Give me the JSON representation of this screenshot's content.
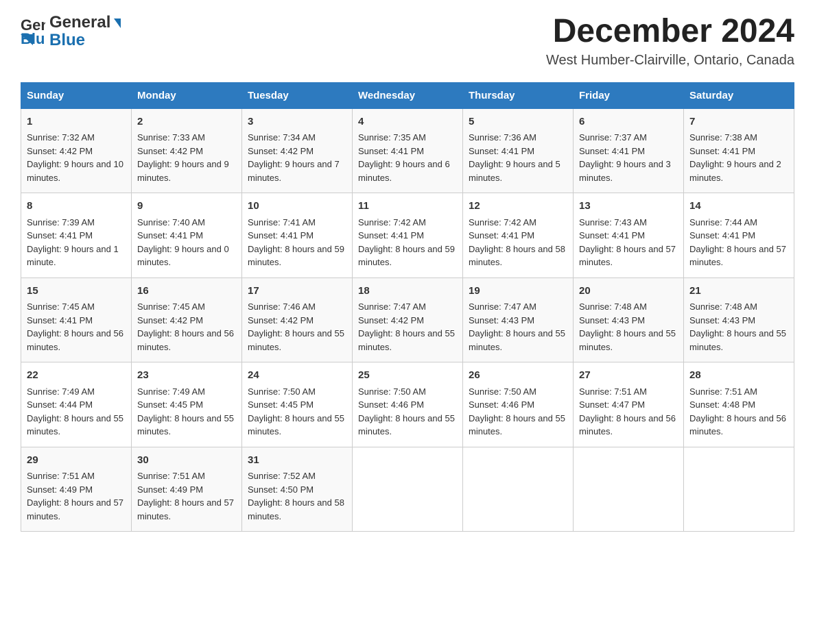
{
  "header": {
    "logo": {
      "text_general": "General",
      "text_blue": "Blue",
      "triangle_color": "#1a6faf"
    },
    "title": "December 2024",
    "location": "West Humber-Clairville, Ontario, Canada"
  },
  "weekdays": [
    "Sunday",
    "Monday",
    "Tuesday",
    "Wednesday",
    "Thursday",
    "Friday",
    "Saturday"
  ],
  "weeks": [
    [
      {
        "day": "1",
        "sunrise": "7:32 AM",
        "sunset": "4:42 PM",
        "daylight": "9 hours and 10 minutes."
      },
      {
        "day": "2",
        "sunrise": "7:33 AM",
        "sunset": "4:42 PM",
        "daylight": "9 hours and 9 minutes."
      },
      {
        "day": "3",
        "sunrise": "7:34 AM",
        "sunset": "4:42 PM",
        "daylight": "9 hours and 7 minutes."
      },
      {
        "day": "4",
        "sunrise": "7:35 AM",
        "sunset": "4:41 PM",
        "daylight": "9 hours and 6 minutes."
      },
      {
        "day": "5",
        "sunrise": "7:36 AM",
        "sunset": "4:41 PM",
        "daylight": "9 hours and 5 minutes."
      },
      {
        "day": "6",
        "sunrise": "7:37 AM",
        "sunset": "4:41 PM",
        "daylight": "9 hours and 3 minutes."
      },
      {
        "day": "7",
        "sunrise": "7:38 AM",
        "sunset": "4:41 PM",
        "daylight": "9 hours and 2 minutes."
      }
    ],
    [
      {
        "day": "8",
        "sunrise": "7:39 AM",
        "sunset": "4:41 PM",
        "daylight": "9 hours and 1 minute."
      },
      {
        "day": "9",
        "sunrise": "7:40 AM",
        "sunset": "4:41 PM",
        "daylight": "9 hours and 0 minutes."
      },
      {
        "day": "10",
        "sunrise": "7:41 AM",
        "sunset": "4:41 PM",
        "daylight": "8 hours and 59 minutes."
      },
      {
        "day": "11",
        "sunrise": "7:42 AM",
        "sunset": "4:41 PM",
        "daylight": "8 hours and 59 minutes."
      },
      {
        "day": "12",
        "sunrise": "7:42 AM",
        "sunset": "4:41 PM",
        "daylight": "8 hours and 58 minutes."
      },
      {
        "day": "13",
        "sunrise": "7:43 AM",
        "sunset": "4:41 PM",
        "daylight": "8 hours and 57 minutes."
      },
      {
        "day": "14",
        "sunrise": "7:44 AM",
        "sunset": "4:41 PM",
        "daylight": "8 hours and 57 minutes."
      }
    ],
    [
      {
        "day": "15",
        "sunrise": "7:45 AM",
        "sunset": "4:41 PM",
        "daylight": "8 hours and 56 minutes."
      },
      {
        "day": "16",
        "sunrise": "7:45 AM",
        "sunset": "4:42 PM",
        "daylight": "8 hours and 56 minutes."
      },
      {
        "day": "17",
        "sunrise": "7:46 AM",
        "sunset": "4:42 PM",
        "daylight": "8 hours and 55 minutes."
      },
      {
        "day": "18",
        "sunrise": "7:47 AM",
        "sunset": "4:42 PM",
        "daylight": "8 hours and 55 minutes."
      },
      {
        "day": "19",
        "sunrise": "7:47 AM",
        "sunset": "4:43 PM",
        "daylight": "8 hours and 55 minutes."
      },
      {
        "day": "20",
        "sunrise": "7:48 AM",
        "sunset": "4:43 PM",
        "daylight": "8 hours and 55 minutes."
      },
      {
        "day": "21",
        "sunrise": "7:48 AM",
        "sunset": "4:43 PM",
        "daylight": "8 hours and 55 minutes."
      }
    ],
    [
      {
        "day": "22",
        "sunrise": "7:49 AM",
        "sunset": "4:44 PM",
        "daylight": "8 hours and 55 minutes."
      },
      {
        "day": "23",
        "sunrise": "7:49 AM",
        "sunset": "4:45 PM",
        "daylight": "8 hours and 55 minutes."
      },
      {
        "day": "24",
        "sunrise": "7:50 AM",
        "sunset": "4:45 PM",
        "daylight": "8 hours and 55 minutes."
      },
      {
        "day": "25",
        "sunrise": "7:50 AM",
        "sunset": "4:46 PM",
        "daylight": "8 hours and 55 minutes."
      },
      {
        "day": "26",
        "sunrise": "7:50 AM",
        "sunset": "4:46 PM",
        "daylight": "8 hours and 55 minutes."
      },
      {
        "day": "27",
        "sunrise": "7:51 AM",
        "sunset": "4:47 PM",
        "daylight": "8 hours and 56 minutes."
      },
      {
        "day": "28",
        "sunrise": "7:51 AM",
        "sunset": "4:48 PM",
        "daylight": "8 hours and 56 minutes."
      }
    ],
    [
      {
        "day": "29",
        "sunrise": "7:51 AM",
        "sunset": "4:49 PM",
        "daylight": "8 hours and 57 minutes."
      },
      {
        "day": "30",
        "sunrise": "7:51 AM",
        "sunset": "4:49 PM",
        "daylight": "8 hours and 57 minutes."
      },
      {
        "day": "31",
        "sunrise": "7:52 AM",
        "sunset": "4:50 PM",
        "daylight": "8 hours and 58 minutes."
      },
      null,
      null,
      null,
      null
    ]
  ],
  "labels": {
    "sunrise": "Sunrise:",
    "sunset": "Sunset:",
    "daylight": "Daylight:"
  }
}
